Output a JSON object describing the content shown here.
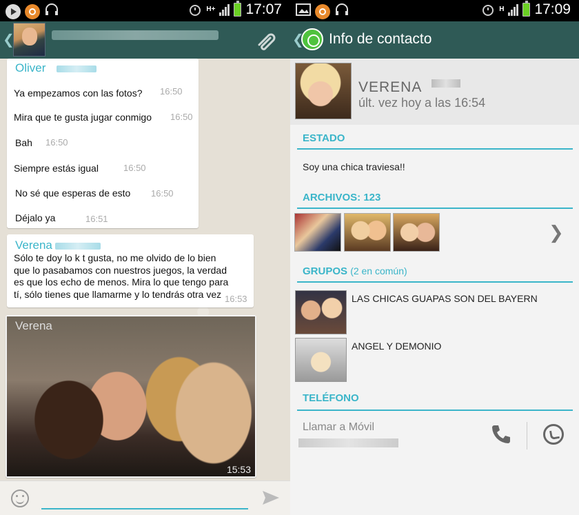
{
  "left_screen": {
    "status_time": "17:07",
    "network": "H+",
    "messages": [
      {
        "text": "Ya empezamos con las fotos?",
        "time": "16:50"
      },
      {
        "text": "Mira que te gusta jugar conmigo",
        "time": "16:50"
      },
      {
        "text": "Bah",
        "time": "16:50"
      },
      {
        "text": "Siempre estás igual",
        "time": "16:50"
      },
      {
        "text": "No sé que esperas de esto",
        "time": "16:50"
      },
      {
        "text": "Déjalo ya",
        "time": "16:51"
      }
    ],
    "sender_1": "Oliver",
    "sender_2": "Verena",
    "long_message": "Sólo te doy lo k t gusta, no me olvido de lo bien que lo pasabamos con nuestros juegos, la verdad es que los echo de menos. Mira lo que tengo para tí, sólo tienes que llamarme y lo tendrás otra vez",
    "long_message_time": "16:53",
    "photo_sender": "Verena",
    "photo_time": "15:53"
  },
  "right_screen": {
    "status_time": "17:09",
    "network": "H",
    "header_title": "Info de contacto",
    "contact_name": "VERENA",
    "last_seen": "últ. vez hoy a las 16:54",
    "estado_label": "ESTADO",
    "estado_text": "Soy una chica traviesa!!",
    "archivos_label": "ARCHIVOS: 123",
    "grupos_label": "GRUPOS",
    "grupos_count": "(2 en común)",
    "groups": [
      {
        "name": "LAS CHICAS GUAPAS SON DEL BAYERN"
      },
      {
        "name": "ANGEL Y DEMONIO"
      }
    ],
    "telefono_label": "TELÉFONO",
    "call_label": "Llamar a Móvil"
  }
}
